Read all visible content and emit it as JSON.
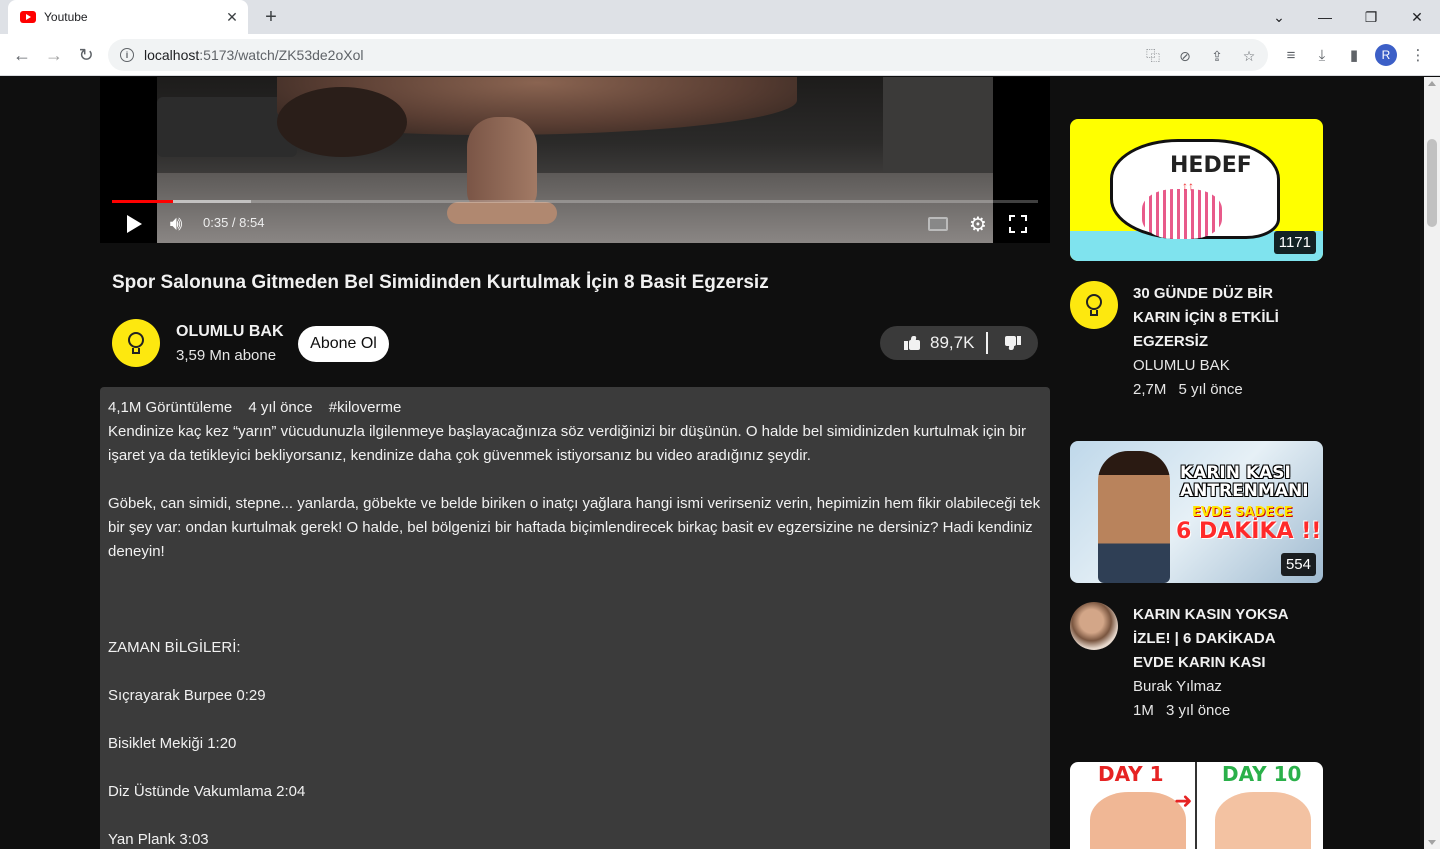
{
  "browser": {
    "tab_title": "Youtube",
    "url_host": "localhost",
    "url_path": ":5173/watch/ZK53de2oXol",
    "profile_initial": "R"
  },
  "player": {
    "time_current": "0:35",
    "time_separator": " / ",
    "time_total": "8:54",
    "progress_played": 0.066,
    "progress_buffered": 0.15
  },
  "video": {
    "title": "Spor Salonuna Gitmeden Bel Simidinden Kurtulmak İçin 8 Basit Egzersiz",
    "channel_name": "OLUMLU BAK",
    "subscribers": "3,59 Mn abone",
    "subscribe_label": "Abone Ol",
    "likes": "89,7K"
  },
  "description": {
    "views": "4,1M Görüntüleme",
    "age": "4 yıl önce",
    "hashtag": "#kiloverme",
    "paragraphs": [
      "Kendinize kaç kez “yarın” vücudunuzla ilgilenmeye başlayacağınıza söz verdiğinizi bir düşünün. O halde bel simidinizden kurtulmak için bir işaret ya da tetikleyici bekliyorsanız, kendinize daha çok güvenmek istiyorsanız bu video aradığınız şeydir.",
      "Göbek, can simidi, stepne... yanlarda, göbekte ve belde biriken o inatçı yağlara hangi ismi verirseniz verin, hepimizin hem fikir olabileceği tek bir şey var: ondan kurtulmak gerek! O halde, bel bölgenizi bir haftada biçimlendirecek birkaç basit ev egzersizine ne dersiniz? Hadi kendiniz deneyin!",
      "ZAMAN BİLGİLERİ:",
      "Sıçrayarak Burpee 0:29",
      "Bisiklet Mekiği 1:20",
      "Diz Üstünde Vakumlama 2:04",
      "Yan Plank 3:03"
    ]
  },
  "recommendations": [
    {
      "title": "30 GÜNDE DÜZ BİR KARIN İÇİN 8 ETKİLİ EGZERSİZ",
      "channel": "OLUMLU BAK",
      "views": "2,7M",
      "age": "5 yıl önce",
      "duration": "1171",
      "thumb_text": "HEDEF"
    },
    {
      "title": "KARIN KASIN YOKSA İZLE! | 6 DAKİKADA EVDE KARIN KASI",
      "channel": "Burak Yılmaz",
      "views": "1M",
      "age": "3 yıl önce",
      "duration": "554",
      "thumb_text_1": "KARIN KASI",
      "thumb_text_2": "ANTRENMANI",
      "thumb_text_3": "EVDE SADECE",
      "thumb_text_4": "6 DAKİKA !!"
    },
    {
      "thumb_text_1": "DAY 1",
      "thumb_text_2": "DAY 10"
    }
  ],
  "colors": {
    "background": "#0f0f0f",
    "accent_red": "#ff0000",
    "description_bg": "#3b3b3b",
    "pill_bg": "#3a3a3a"
  }
}
